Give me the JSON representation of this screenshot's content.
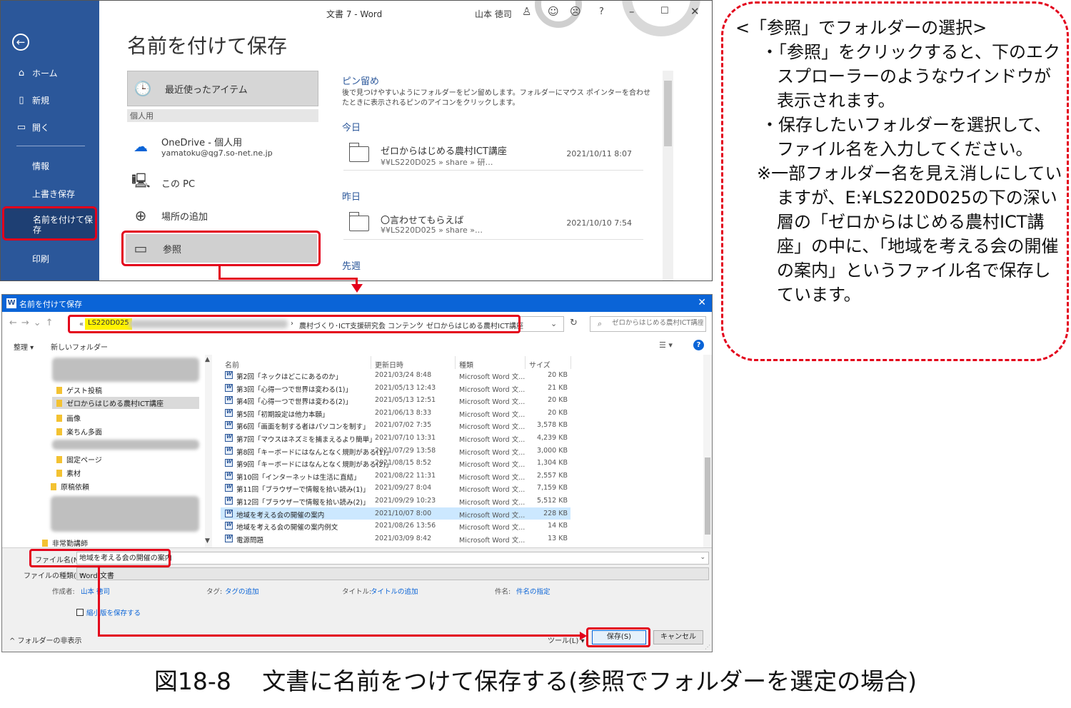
{
  "backstage": {
    "window_title": "文書 7  -  Word",
    "user": "山本 徳司",
    "heading": "名前を付けて保存",
    "nav": {
      "home": "ホーム",
      "new": "新規",
      "open": "開く",
      "info": "情報",
      "save": "上書き保存",
      "save_as": "名前を付けて保存",
      "print": "印刷"
    },
    "locations": {
      "recent": "最近使ったアイテム",
      "personal_header": "個人用",
      "onedrive_name": "OneDrive - 個人用",
      "onedrive_email": "yamatoku@qg7.so-net.ne.jp",
      "this_pc": "この PC",
      "add_place": "場所の追加",
      "browse": "参照"
    },
    "pinned_title": "ピン留め",
    "pinned_desc": "後で見つけやすいようにフォルダーをピン留めします。フォルダーにマウス ポインターを合わせたときに表示されるピンのアイコンをクリックします。",
    "today_label": "今日",
    "yesterday_label": "昨日",
    "last_week_label": "先週",
    "recent_folders": [
      {
        "name": "ゼロからはじめる農村ICT講座",
        "path": "¥¥LS220D025 » share » 研…",
        "date": "2021/10/11 8:07"
      },
      {
        "name": "〇言わせてもらえば",
        "path": "¥¥LS220D025 » share »…",
        "date": "2021/10/10 7:54"
      }
    ]
  },
  "callout": {
    "title": "<「参照」でフォルダーの選択>",
    "bullet1": "・「参照」をクリックすると、下のエクスプローラーのようなウインドウが表示されます。",
    "bullet2": "・保存したいフォルダーを選択して、ファイル名を入力してください。",
    "note": "※一部フォルダー名を見え消しにしていますが、E:¥LS220D025の下の深い層の「ゼロからはじめる農村ICT講座」の中に、「地域を考える会の開催の案内」というファイル名で保存しています。"
  },
  "dialog": {
    "title": "名前を付けて保存",
    "address": {
      "chevron": "«",
      "root": "LS220D025",
      "seg1": "農村づくり･ICT支援研究会",
      "seg2": "コンテンツ",
      "seg3": "ゼロからはじめる農村ICT講座"
    },
    "search_placeholder": "ゼロからはじめる農村ICT講座の...",
    "organize": "整理 ▾",
    "new_folder": "新しいフォルダー",
    "tree": {
      "guest": "ゲスト投稿",
      "selected": "ゼロからはじめる農村ICT講座",
      "images": "画像",
      "rakuchin": "楽ちん多面",
      "fixed": "固定ページ",
      "materials": "素材",
      "manuscript": "原稿依頼",
      "parttime": "非常勤講師"
    },
    "columns": {
      "name": "名前",
      "date": "更新日時",
      "type": "種類",
      "size": "サイズ"
    },
    "files": [
      {
        "name": "第2回「ネックはどこにあるのか」",
        "date": "2021/03/24 8:48",
        "type": "Microsoft Word 文...",
        "size": "20 KB"
      },
      {
        "name": "第3回「心得一つで世界は変わる(1)」",
        "date": "2021/05/13 12:43",
        "type": "Microsoft Word 文...",
        "size": "21 KB"
      },
      {
        "name": "第4回「心得一つで世界は変わる(2)」",
        "date": "2021/05/13 12:51",
        "type": "Microsoft Word 文...",
        "size": "20 KB"
      },
      {
        "name": "第5回「初期設定は他力本願」",
        "date": "2021/06/13 8:33",
        "type": "Microsoft Word 文...",
        "size": "20 KB"
      },
      {
        "name": "第6回「画面を制する者はパソコンを制す」",
        "date": "2021/07/02 7:35",
        "type": "Microsoft Word 文...",
        "size": "3,578 KB"
      },
      {
        "name": "第7回「マウスはネズミを捕まえるより簡単」",
        "date": "2021/07/10 13:31",
        "type": "Microsoft Word 文...",
        "size": "4,239 KB"
      },
      {
        "name": "第8回「キーボードにはなんとなく規則がある(1)」",
        "date": "2021/07/29 13:58",
        "type": "Microsoft Word 文...",
        "size": "3,000 KB"
      },
      {
        "name": "第9回「キーボードにはなんとなく規則がある(2)」",
        "date": "2021/08/15 8:52",
        "type": "Microsoft Word 文...",
        "size": "1,304 KB"
      },
      {
        "name": "第10回「インターネットは生活に直結」",
        "date": "2021/08/22 11:31",
        "type": "Microsoft Word 文...",
        "size": "2,557 KB"
      },
      {
        "name": "第11回「ブラウザーで情報を拾い読み(1)」",
        "date": "2021/09/27 8:04",
        "type": "Microsoft Word 文...",
        "size": "7,159 KB"
      },
      {
        "name": "第12回「ブラウザーで情報を拾い読み(2)」",
        "date": "2021/09/29 10:23",
        "type": "Microsoft Word 文...",
        "size": "5,512 KB"
      },
      {
        "name": "地域を考える会の開催の案内",
        "date": "2021/10/07 8:00",
        "type": "Microsoft Word 文...",
        "size": "228 KB"
      },
      {
        "name": "地域を考える会の開催の案内例文",
        "date": "2021/08/26 13:56",
        "type": "Microsoft Word 文...",
        "size": "14 KB"
      },
      {
        "name": "電源問題",
        "date": "2021/03/09 8:42",
        "type": "Microsoft Word 文...",
        "size": "13 KB"
      }
    ],
    "filename_label": "ファイル名(N):",
    "filename_value": "地域を考える会の開催の案内",
    "filetype_label": "ファイルの種類(T):",
    "filetype_value": "Word 文書",
    "author_label": "作成者:",
    "author_value": "山本 徳司",
    "tags_label": "タグ:",
    "tags_value": "タグの追加",
    "title_label": "タイトル:",
    "title_value": "タイトルの追加",
    "subject_label": "件名:",
    "subject_value": "件名の指定",
    "thumbnail": "縮小版を保存する",
    "hide_folders": "^ フォルダーの非表示",
    "tools": "ツール(L) ▾",
    "save_btn": "保存(S)",
    "cancel_btn": "キャンセル"
  },
  "caption": "図18-8　 文書に名前をつけて保存する(参照でフォルダーを選定の場合)"
}
